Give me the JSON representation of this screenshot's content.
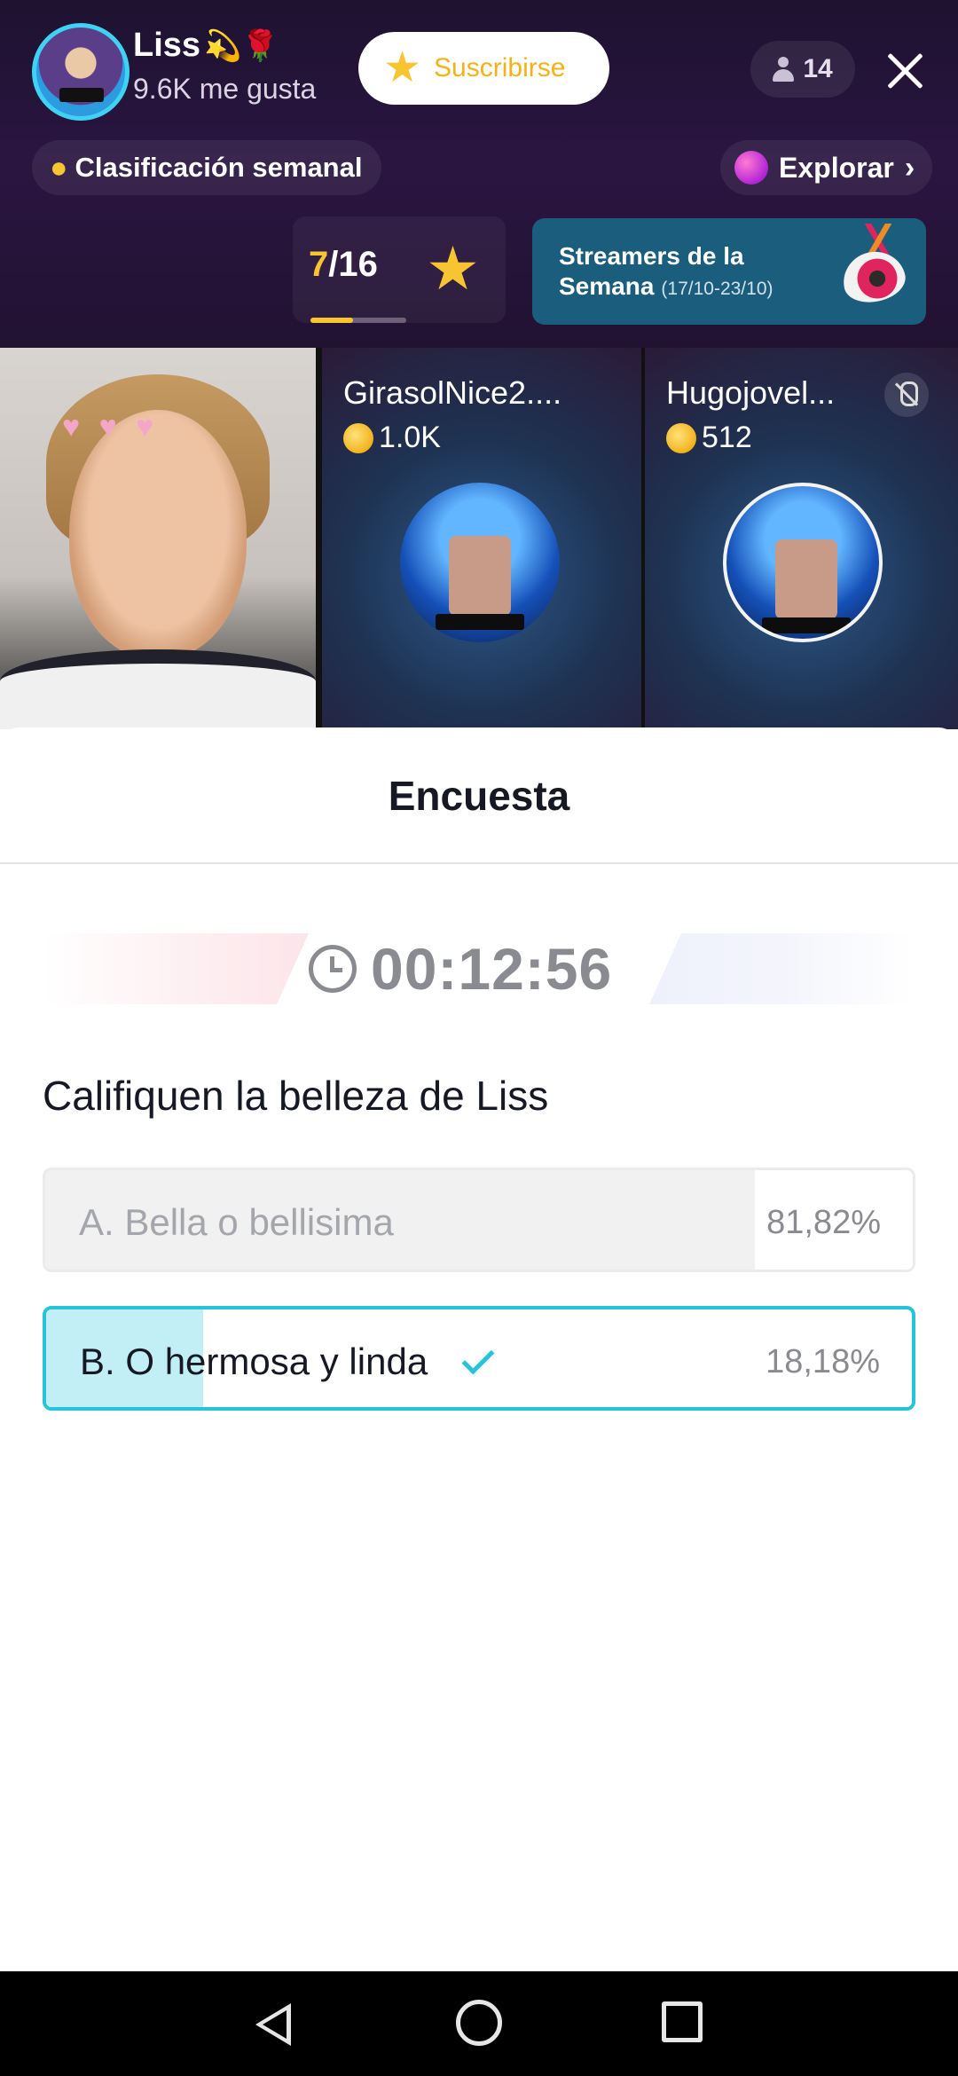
{
  "header": {
    "host_name": "Liss",
    "host_name_emoji": "💫🌹",
    "likes": "9.6K me gusta",
    "subscribe_label": "Suscribirse",
    "viewer_count": "14",
    "weekly_ranking_label": "Clasificación semanal",
    "explore_label": "Explorar"
  },
  "rank": {
    "current": "7",
    "separator": "/",
    "total": "16",
    "progress": 0.44
  },
  "banner": {
    "title": "Streamers de la Semana",
    "dates": "(17/10-23/10)"
  },
  "guests": [
    {
      "name": "GirasolNice2....",
      "coins": "1.0K"
    },
    {
      "name": "Hugojovel...",
      "coins": "512"
    }
  ],
  "poll": {
    "title": "Encuesta",
    "timer": "00:12:56",
    "question": "Califiquen la belleza de Liss",
    "options": [
      {
        "label": "A. Bella o bellisima",
        "percent": "81,82%",
        "fraction": 0.8182,
        "selected": false
      },
      {
        "label": "B. O hermosa y linda",
        "percent": "18,18%",
        "fraction": 0.1818,
        "selected": true
      }
    ]
  },
  "colors": {
    "accent": "#25c4d9",
    "gold": "#f7c531",
    "header_bg": "#221232"
  },
  "icons": {
    "close": "close-icon",
    "viewer": "person-icon",
    "clock": "clock-icon",
    "check": "check-icon",
    "star": "star-icon",
    "mic_off": "mic-off-icon"
  }
}
